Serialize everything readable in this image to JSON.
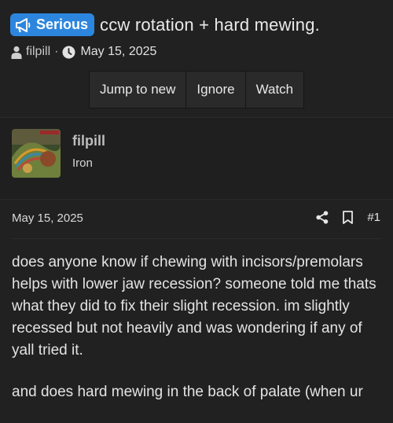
{
  "thread": {
    "prefix": "Serious",
    "title": "ccw rotation + hard mewing.",
    "author": "filpill",
    "separator": "·",
    "date": "May 15, 2025"
  },
  "actions": {
    "jump_to_new": "Jump to new",
    "ignore": "Ignore",
    "watch": "Watch"
  },
  "post": {
    "username": "filpill",
    "user_title": "Iron",
    "date": "May 15, 2025",
    "number": "#1",
    "paragraphs": [
      "does anyone know if chewing with incisors/premolars helps with lower jaw recession? someone told me thats what they did to fix their slight recession. im slightly recessed but not heavily and was wondering if any of yall tried it.",
      "and does hard mewing in the back of palate (when ur"
    ]
  },
  "colors": {
    "badge": "#2d86de",
    "background": "#212121"
  },
  "icons": [
    "megaphone-icon",
    "user-icon",
    "clock-icon",
    "share-icon",
    "bookmark-icon"
  ]
}
